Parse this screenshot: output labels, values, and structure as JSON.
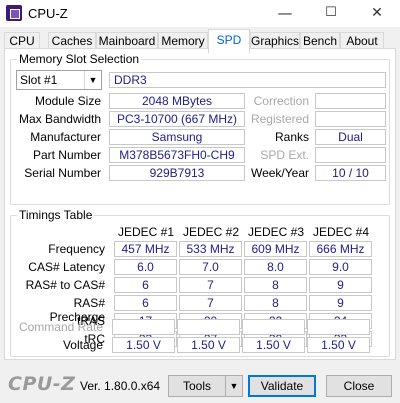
{
  "window": {
    "title": "CPU-Z",
    "controls": {
      "minimize": "—",
      "maximize": "☐",
      "close": "✕"
    }
  },
  "tabs": [
    "CPU",
    "Caches",
    "Mainboard",
    "Memory",
    "SPD",
    "Graphics",
    "Bench",
    "About"
  ],
  "active_tab": "SPD",
  "slot": {
    "group_label": "Memory Slot Selection",
    "selected": "Slot #1",
    "type": "DDR3",
    "labels": {
      "module_size": "Module Size",
      "max_bandwidth": "Max Bandwidth",
      "manufacturer": "Manufacturer",
      "part_number": "Part Number",
      "serial_number": "Serial Number",
      "correction": "Correction",
      "registered": "Registered",
      "ranks": "Ranks",
      "spd_ext": "SPD Ext.",
      "week_year": "Week/Year"
    },
    "values": {
      "module_size": "2048 MBytes",
      "max_bandwidth": "PC3-10700 (667 MHz)",
      "manufacturer": "Samsung",
      "part_number": "M378B5673FH0-CH9",
      "serial_number": "929B7913",
      "correction": "",
      "registered": "",
      "ranks": "Dual",
      "spd_ext": "",
      "week_year": "10 / 10"
    }
  },
  "timings": {
    "group_label": "Timings Table",
    "columns": [
      "JEDEC #1",
      "JEDEC #2",
      "JEDEC #3",
      "JEDEC #4"
    ],
    "rows": [
      {
        "label": "Frequency",
        "values": [
          "457 MHz",
          "533 MHz",
          "609 MHz",
          "666 MHz"
        ]
      },
      {
        "label": "CAS# Latency",
        "values": [
          "6.0",
          "7.0",
          "8.0",
          "9.0"
        ]
      },
      {
        "label": "RAS# to CAS#",
        "values": [
          "6",
          "7",
          "8",
          "9"
        ]
      },
      {
        "label": "RAS# Precharge",
        "values": [
          "6",
          "7",
          "8",
          "9"
        ]
      },
      {
        "label": "tRAS",
        "values": [
          "17",
          "20",
          "22",
          "24"
        ]
      },
      {
        "label": "tRC",
        "values": [
          "23",
          "27",
          "30",
          "33"
        ]
      },
      {
        "label": "Command Rate",
        "values": [
          "",
          "",
          "",
          ""
        ]
      },
      {
        "label": "Voltage",
        "values": [
          "1.50 V",
          "1.50 V",
          "1.50 V",
          "1.50 V"
        ]
      }
    ]
  },
  "footer": {
    "brand": "CPU-Z",
    "version": "Ver. 1.80.0.x64",
    "tools": "Tools",
    "tools_arrow": "▼",
    "validate": "Validate",
    "close": "Close"
  }
}
